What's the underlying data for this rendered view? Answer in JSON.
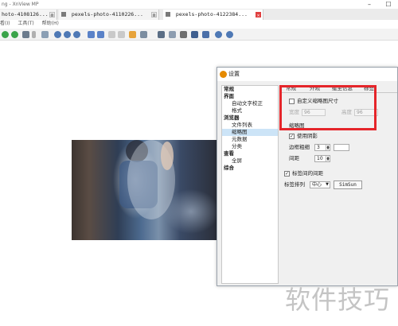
{
  "window": {
    "title": "ng - XnView MP",
    "minimize": "–",
    "maximize": "☐"
  },
  "tabs": [
    {
      "label": "hoto-4108126....",
      "close": "⊠"
    },
    {
      "label": "pexels-photo-4110226...",
      "close": "⊠"
    },
    {
      "label": "pexels-photo-4122384...",
      "close": "✕"
    }
  ],
  "menu": {
    "items": [
      "看(I)",
      "工具(T)",
      "帮助(H)"
    ]
  },
  "dialog": {
    "title": "设置",
    "tree": [
      {
        "label": "常规",
        "level": 0
      },
      {
        "label": "界面",
        "level": 0
      },
      {
        "label": "自动文字校正",
        "level": 1
      },
      {
        "label": "格式",
        "level": 1
      },
      {
        "label": "浏览器",
        "level": 0
      },
      {
        "label": "文件列表",
        "level": 1
      },
      {
        "label": "缩略图",
        "level": 1,
        "selected": true
      },
      {
        "label": "元数据",
        "level": 1
      },
      {
        "label": "分类",
        "level": 1
      },
      {
        "label": "查看",
        "level": 0
      },
      {
        "label": "全屏",
        "level": 1
      },
      {
        "label": "综合",
        "level": 0
      }
    ],
    "subtabs": [
      "常规",
      "外观",
      "缓至信息",
      "标签"
    ],
    "custom_size": {
      "label": "自定义缩略图尺寸",
      "checked": false,
      "width_label": "宽度",
      "width_value": "96",
      "height_label": "高度",
      "height_value": "96"
    },
    "thumbnail_group": {
      "title": "缩略图",
      "shadow_label": "使用阴影",
      "shadow_checked": true,
      "border_label": "边框粗细",
      "border_value": "3",
      "spacing_label": "间距",
      "spacing_value": "10"
    },
    "label_spacing": {
      "label": "标签间的间距",
      "checked": true
    },
    "label_align": {
      "label": "标签排列",
      "value": "中心",
      "font_button": "SimSun"
    }
  },
  "watermark": "软件技巧"
}
